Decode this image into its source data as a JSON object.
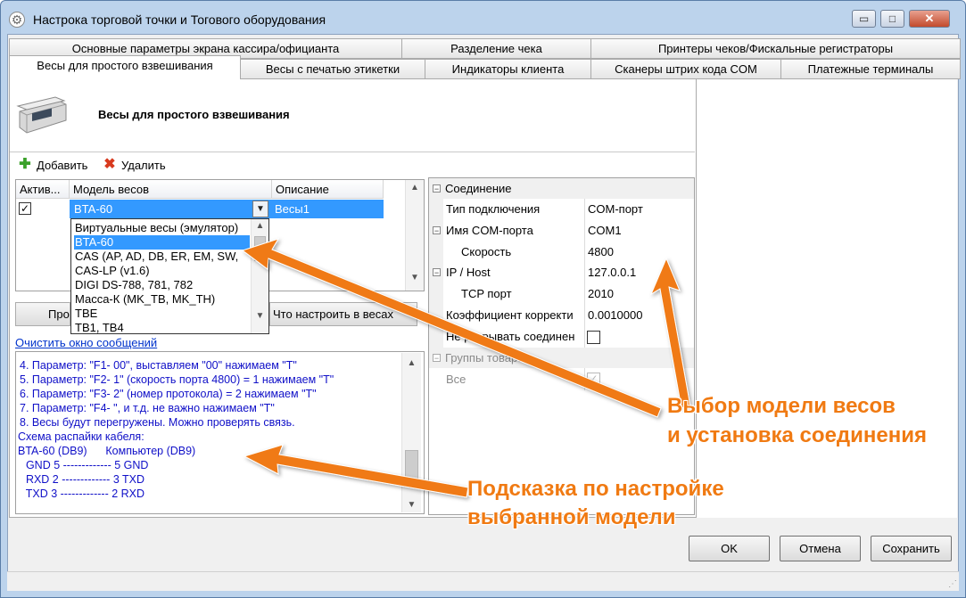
{
  "window": {
    "title": "Настрока торговой точки и Тогового оборудования",
    "minimize_glyph": "▭",
    "maximize_glyph": "□",
    "close_glyph": "✕"
  },
  "tabs_row1": [
    "Основные параметры экрана кассира/официанта",
    "Разделение чека",
    "Принтеры чеков/Фискальные регистраторы"
  ],
  "tabs_row2": [
    "Весы для простого взвешивания",
    "Весы с печатью этикетки",
    "Индикаторы клиента",
    "Сканеры штрих кода COM",
    "Платежные терминалы"
  ],
  "header": {
    "title": "Весы для простого взвешивания",
    "icon": "scale-icon"
  },
  "toolbar": {
    "add_label": "Добавить",
    "add_icon": "plus-icon",
    "delete_label": "Удалить",
    "delete_icon": "delete-icon"
  },
  "grid": {
    "columns": [
      "Актив...",
      "Модель весов",
      "Описание"
    ],
    "rows": [
      {
        "active": "✓",
        "model": "BTA-60",
        "description": "Весы1"
      }
    ]
  },
  "dropdown": {
    "items": [
      "Виртуальные весы (эмулятор)",
      "BTA-60",
      "CAS (AP, AD, DB, ER, EM, SW,",
      "CAS-LP (v1.6)",
      "DIGI DS-788, 781, 782",
      "Масса-К (MK_TB, MK_TH)",
      "TBE",
      "TB1, TB4"
    ],
    "selected_index": 1
  },
  "buttons": {
    "check_label": "Про",
    "setup_label": "Что настроить в весах"
  },
  "clear_link": "Очистить окно сообщений",
  "log_lines": [
    "4. Параметр: \"F1- 00\", выставляем \"00\" нажимаем \"T\"",
    "5. Параметр: \"F2- 1\" (скорость порта 4800) = 1 нажимаем \"T\"",
    "6. Параметр: \"F3- 2\" (номер протокола) = 2 нажимаем \"T\"",
    "7. Параметр: \"F4- \", и т.д. не важно нажимаем \"T\"",
    "8. Весы будут перегружены. Можно проверять связь.",
    "Схема распайки кабеля:",
    "BTA-60 (DB9)      Компьютер (DB9)",
    "  GND 5 ------------- 5 GND",
    "  RXD 2 ------------- 3 TXD",
    "  TXD 3 ------------- 2 RXD"
  ],
  "properties": {
    "cat_connection": "Соединение",
    "conn_type_name": "Тип подключения",
    "conn_type_value": "COM-порт",
    "com_name": "Имя COM-порта",
    "com_value": "COM1",
    "speed_name": "Скорость",
    "speed_value": "4800",
    "ip_name": "IP / Host",
    "ip_value": "127.0.0.1",
    "tcp_name": "TCP порт",
    "tcp_value": "2010",
    "coef_name": "Коэффициент корректи",
    "coef_value": "0.0010000",
    "nobreak_name": "Не разрывать соединен",
    "cat_groups": "Группы товаров",
    "all_name": "Все",
    "all_value": "✓"
  },
  "dialog_buttons": {
    "ok": "OK",
    "cancel": "Отмена",
    "save": "Сохранить"
  },
  "annotations": {
    "callout1_line1": "Выбор модели весов",
    "callout1_line2": "и установка соединения",
    "callout2_line1": "Подсказка по настройке",
    "callout2_line2": "выбранной модели",
    "color": "#f07a12"
  }
}
